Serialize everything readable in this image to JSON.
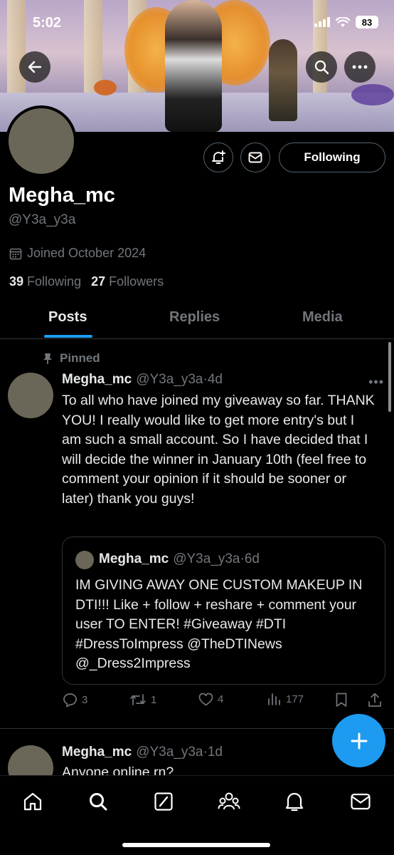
{
  "status_bar": {
    "time": "5:02",
    "battery": "83"
  },
  "profile": {
    "display_name": "Megha_mc",
    "handle": "@Y3a_y3a",
    "joined": "Joined October 2024",
    "following_count": "39",
    "following_label": "Following",
    "followers_count": "27",
    "followers_label": "Followers",
    "follow_button": "Following"
  },
  "tabs": [
    {
      "label": "Posts",
      "active": true
    },
    {
      "label": "Replies",
      "active": false
    },
    {
      "label": "Media",
      "active": false
    }
  ],
  "pinned_post": {
    "pinned_label": "Pinned",
    "author": "Megha_mc",
    "handle": "@Y3a_y3a",
    "age": "4d",
    "text": "To all who have joined my giveaway so far. THANK YOU! I really would like to get more entry's but I am such a small account. So I have decided that I will decide the winner in January 10th (feel free to comment your opinion if it should be sooner or later) thank you guys!",
    "quote": {
      "author": "Megha_mc",
      "handle": "@Y3a_y3a",
      "age": "6d",
      "text": "IM GIVING AWAY ONE CUSTOM MAKEUP IN DTI!!! Like + follow + reshare + comment your user TO ENTER! #Giveaway #DTI #DressToImpress @TheDTINews @_Dress2Impress"
    },
    "replies": "3",
    "reposts": "1",
    "likes": "4",
    "views": "177"
  },
  "second_post": {
    "author": "Megha_mc",
    "handle": "@Y3a_y3a",
    "age": "1d",
    "text": "Anyone online rn?"
  },
  "colors": {
    "accent": "#1d9bf0",
    "background": "#000000",
    "muted": "#71767b"
  },
  "icons": [
    "back-arrow-icon",
    "search-icon",
    "more-icon",
    "notify-bell-icon",
    "mail-icon",
    "calendar-icon",
    "pin-icon",
    "reply-icon",
    "repost-icon",
    "like-icon",
    "views-icon",
    "bookmark-icon",
    "share-icon",
    "compose-icon",
    "home-icon",
    "grok-icon",
    "communities-icon",
    "notifications-icon",
    "messages-icon"
  ]
}
